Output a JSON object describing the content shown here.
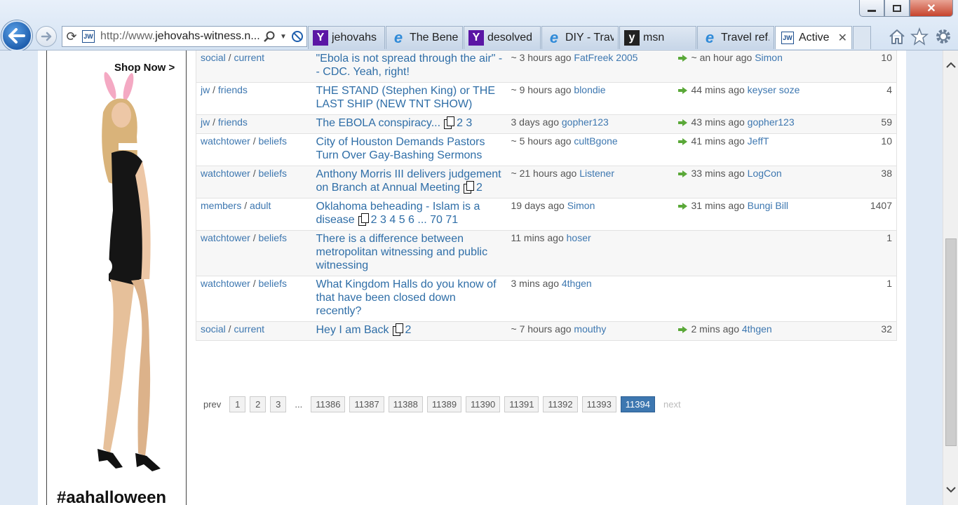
{
  "browser": {
    "url_prefix": "http://www.",
    "url_domain": "jehovahs-witness.n...",
    "tabs": [
      {
        "label": "jehovahs ...",
        "icon": "yahoo-icon",
        "active": false
      },
      {
        "label": "The Benef...",
        "icon": "ie-icon",
        "active": false
      },
      {
        "label": "desolved ...",
        "icon": "yahoo-icon",
        "active": false
      },
      {
        "label": "DIY - Trav...",
        "icon": "ie-icon",
        "active": false
      },
      {
        "label": "msn",
        "icon": "msn-icon",
        "active": false
      },
      {
        "label": "Travel ref...",
        "icon": "ie-icon",
        "active": false
      },
      {
        "label": "Active ...",
        "icon": "jw-icon",
        "active": true
      }
    ],
    "favicon_text": "JW",
    "close_tab_glyph": "✕"
  },
  "ad": {
    "shop_now": "Shop Now >",
    "hashtag": "#aahalloween"
  },
  "topics": [
    {
      "category": "social",
      "subcategory": "current",
      "title": "\"Ebola is not spread through the air\" -- CDC. Yeah, right!",
      "pages": "",
      "started": "~ 3 hours ago",
      "starter": "FatFreek 2005",
      "last": "~ an hour ago",
      "last_user": "Simon",
      "replies": "10"
    },
    {
      "category": "jw",
      "subcategory": "friends",
      "title": "THE STAND (Stephen King) or THE LAST SHIP (NEW TNT SHOW)",
      "pages": "",
      "started": "~ 9 hours ago",
      "starter": "blondie",
      "last": "44 mins ago",
      "last_user": "keyser soze",
      "replies": "4"
    },
    {
      "category": "jw",
      "subcategory": "friends",
      "title": "The EBOLA conspiracy...",
      "pages": "2 3",
      "started": "3 days ago",
      "starter": "gopher123",
      "last": "43 mins ago",
      "last_user": "gopher123",
      "replies": "59"
    },
    {
      "category": "watchtower",
      "subcategory": "beliefs",
      "title": "City of Houston Demands Pastors Turn Over Gay-Bashing Sermons",
      "pages": "",
      "started": "~ 5 hours ago",
      "starter": "cultBgone",
      "last": "41 mins ago",
      "last_user": "JeffT",
      "replies": "10"
    },
    {
      "category": "watchtower",
      "subcategory": "beliefs",
      "title": "Anthony Morris III delivers judgement on Branch at Annual Meeting",
      "pages": "2",
      "started": "~ 21 hours ago",
      "starter": "Listener",
      "last": "33 mins ago",
      "last_user": "LogCon",
      "replies": "38"
    },
    {
      "category": "members",
      "subcategory": "adult",
      "title": "Oklahoma beheading - Islam is a disease",
      "pages": "2 3 4 5 6 ... 70 71",
      "started": "19 days ago",
      "starter": "Simon",
      "last": "31 mins ago",
      "last_user": "Bungi Bill",
      "replies": "1407"
    },
    {
      "category": "watchtower",
      "subcategory": "beliefs",
      "title": "There is a difference between metropolitan witnessing and public witnessing",
      "pages": "",
      "started": "11 mins ago",
      "starter": "hoser",
      "last": "",
      "last_user": "",
      "replies": "1"
    },
    {
      "category": "watchtower",
      "subcategory": "beliefs",
      "title": "What Kingdom Halls do you know of that have been closed down recently?",
      "pages": "",
      "started": "3 mins ago",
      "starter": "4thgen",
      "last": "",
      "last_user": "",
      "replies": "1"
    },
    {
      "category": "social",
      "subcategory": "current",
      "title": "Hey I am Back",
      "pages": "2",
      "started": "~ 7 hours ago",
      "starter": "mouthy",
      "last": "2 mins ago",
      "last_user": "4thgen",
      "replies": "32"
    }
  ],
  "pagination": {
    "prev": "prev",
    "early_pages": [
      "1",
      "2",
      "3"
    ],
    "ellipsis": "...",
    "late_pages": [
      "11386",
      "11387",
      "11388",
      "11389",
      "11390",
      "11391",
      "11392",
      "11393"
    ],
    "current": "11394",
    "next": "next"
  },
  "colors": {
    "link": "#3d77b0",
    "current_page": "#3d77b0",
    "arrow": "#5aa838"
  }
}
